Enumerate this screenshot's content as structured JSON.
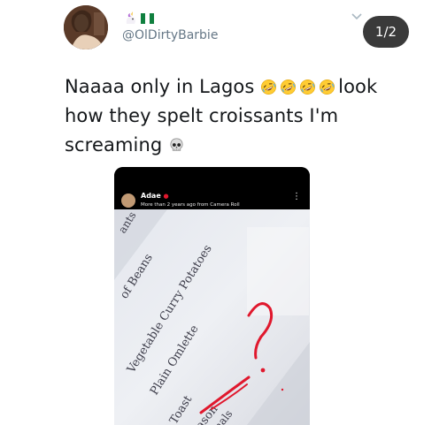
{
  "tweet": {
    "handle": "@OlDirtyBarbie",
    "name_emojis": [
      "unicorn-emoji",
      "nigeria-flag-emoji"
    ],
    "text_line1": "Naaaa only in Lagos",
    "text_line1_end": "look",
    "text_line2": "how they spelt croissants I'm",
    "text_line3": "screaming",
    "laugh_emoji_count": 4
  },
  "media": {
    "counter": "1/2",
    "story": {
      "username": "Adae",
      "subtitle": "More than 2 years ago from Camera Roll"
    },
    "menu_items": [
      "ants",
      "of Beans",
      "Vegetable Curry Potatoes",
      "Plain Omlette",
      "Toast",
      "Quason",
      "nals"
    ]
  },
  "colors": {
    "text": "#14171a",
    "handle": "#657786",
    "pill_bg": "#3a3a3a",
    "red_marker": "#e0182d"
  }
}
